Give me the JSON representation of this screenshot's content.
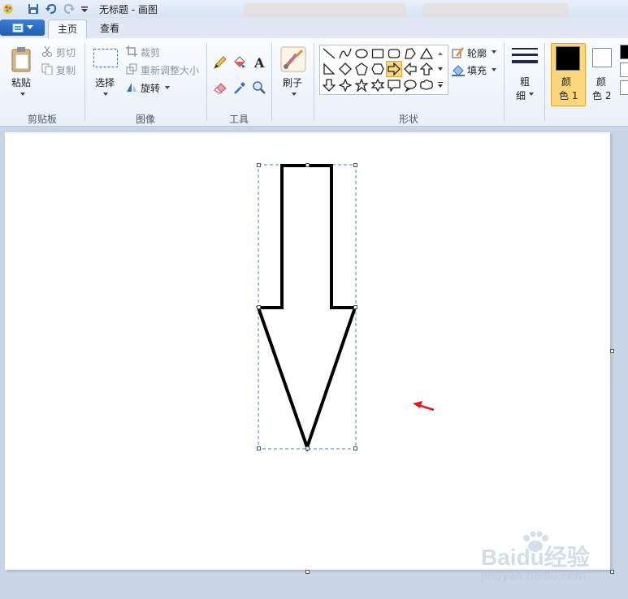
{
  "window": {
    "title": "无标题 - 画图"
  },
  "tabs": [
    {
      "label": "主页",
      "active": true
    },
    {
      "label": "查看",
      "active": false
    }
  ],
  "clipboard": {
    "paste_label": "粘贴",
    "cut_label": "剪切",
    "copy_label": "复制",
    "group_label": "剪贴板"
  },
  "image": {
    "select_label": "选择",
    "crop_label": "裁剪",
    "resize_label": "重新调整大小",
    "rotate_label": "旋转",
    "group_label": "图像"
  },
  "tools": {
    "group_label": "工具"
  },
  "brushes": {
    "label": "刷子"
  },
  "shapes": {
    "outline_label": "轮廓",
    "fill_label": "填充",
    "group_label": "形状",
    "selected_shape": "down-arrow"
  },
  "size": {
    "label_line1": "粗",
    "label_line2": "细"
  },
  "colors": {
    "color1_line1": "颜",
    "color1_line2": "色 1",
    "color2_line1": "颜",
    "color2_line2": "色 2",
    "color1_value": "#000000",
    "color2_value": "#ffffff"
  },
  "watermark": {
    "logo_text": "Baidu经验",
    "url_text": "jingyan.baidu.com"
  },
  "theme": {
    "accent": "#3d7fd0",
    "selected_tool_bg": "#fbd67c",
    "annotation_arrow": "#e01b1b"
  }
}
